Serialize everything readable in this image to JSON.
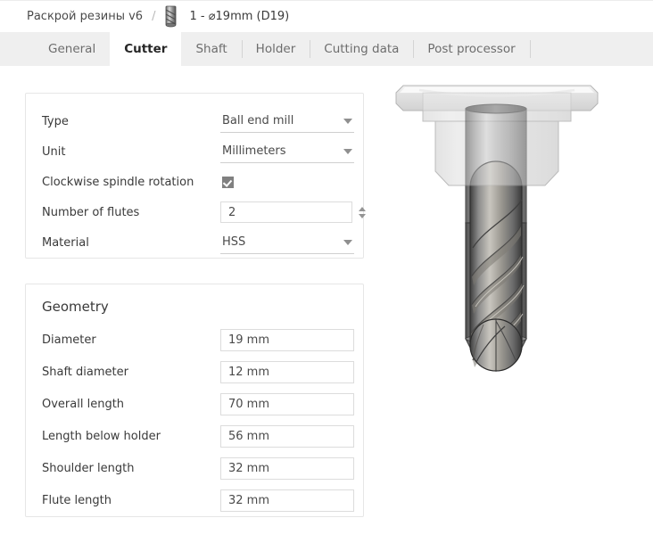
{
  "breadcrumb": {
    "project": "Раскрой резины v6",
    "separator": "/",
    "tool_icon": "end-mill-icon",
    "tool": "1 - ⌀19mm (D19)"
  },
  "tabs": [
    {
      "label": "General",
      "active": false
    },
    {
      "label": "Cutter",
      "active": true
    },
    {
      "label": "Shaft",
      "active": false
    },
    {
      "label": "Holder",
      "active": false
    },
    {
      "label": "Cutting data",
      "active": false
    },
    {
      "label": "Post processor",
      "active": false
    }
  ],
  "cutter_panel": {
    "type": {
      "label": "Type",
      "value": "Ball end mill",
      "control": "dropdown"
    },
    "unit": {
      "label": "Unit",
      "value": "Millimeters",
      "control": "dropdown"
    },
    "clockwise": {
      "label": "Clockwise spindle rotation",
      "checked": true,
      "control": "checkbox"
    },
    "flutes": {
      "label": "Number of flutes",
      "value": "2",
      "control": "spinner"
    },
    "material": {
      "label": "Material",
      "value": "HSS",
      "control": "dropdown"
    }
  },
  "geometry_panel": {
    "title": "Geometry",
    "fields": [
      {
        "label": "Diameter",
        "value": "19 mm"
      },
      {
        "label": "Shaft diameter",
        "value": "12 mm"
      },
      {
        "label": "Overall length",
        "value": "70 mm"
      },
      {
        "label": "Length below holder",
        "value": "56 mm"
      },
      {
        "label": "Shoulder length",
        "value": "32 mm"
      },
      {
        "label": "Flute length",
        "value": "32 mm"
      }
    ]
  },
  "viewport": {
    "model": "ball-end-mill-with-holder",
    "parts": [
      "holder-flange",
      "holder-body",
      "shaft",
      "flute-section",
      "ball-nose-tip"
    ]
  },
  "colors": {
    "tabbar_bg": "#efefef",
    "active_tab_bg": "#ffffff",
    "card_border": "#e6e6e6",
    "label_text": "#3a3a3a",
    "value_text": "#4a4a4a",
    "checkbox_fill": "#808080",
    "input_border": "#dcdcdc"
  }
}
